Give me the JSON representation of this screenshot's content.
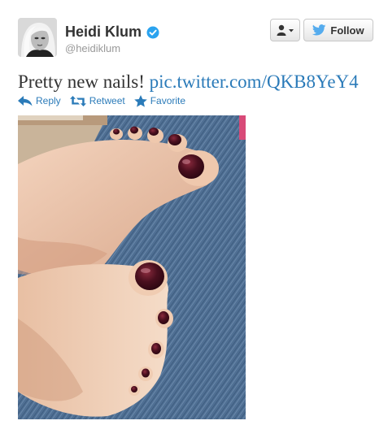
{
  "user": {
    "display_name": "Heidi Klum",
    "screen_name": "@heidiklum",
    "verified": true
  },
  "buttons": {
    "follow_label": "Follow",
    "user_dropdown_icon": "person-icon"
  },
  "tweet": {
    "text": "Pretty new nails! ",
    "link_text": "pic.twitter.com/QKB8YeY4"
  },
  "actions": [
    {
      "label": "Reply",
      "icon": "reply-icon"
    },
    {
      "label": "Retweet",
      "icon": "retweet-icon"
    },
    {
      "label": "Favorite",
      "icon": "star-icon"
    }
  ],
  "colors": {
    "link": "#2b7bb9",
    "verified": "#2aa3ef",
    "twitter_bird": "#55acee",
    "nail_polish": "#4a0f1e"
  }
}
